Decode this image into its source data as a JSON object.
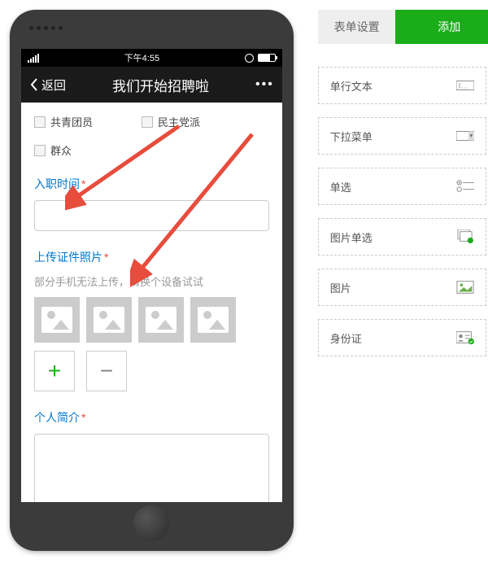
{
  "phone": {
    "status": {
      "time": "下午4:55"
    },
    "nav": {
      "back": "返回",
      "title": "我们开始招聘啦",
      "more": "•••"
    }
  },
  "form": {
    "checkboxes": {
      "opt1": "共青团员",
      "opt2": "民主党派",
      "opt3": "群众"
    },
    "start_date": {
      "label": "入职时间",
      "required": "*"
    },
    "upload": {
      "label": "上传证件照片",
      "required": "*",
      "hint": "部分手机无法上传，请换个设备试试"
    },
    "bio": {
      "label": "个人简介",
      "required": "*"
    },
    "plus": "+",
    "minus": "−"
  },
  "sidebar": {
    "tabs": {
      "settings": "表单设置",
      "add": "添加"
    },
    "items": [
      {
        "label": "单行文本"
      },
      {
        "label": "下拉菜单"
      },
      {
        "label": "单选"
      },
      {
        "label": "图片单选"
      },
      {
        "label": "图片"
      },
      {
        "label": "身份证"
      }
    ]
  }
}
